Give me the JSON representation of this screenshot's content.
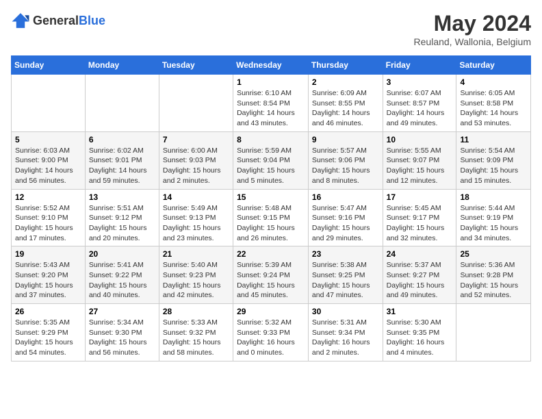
{
  "logo": {
    "general": "General",
    "blue": "Blue"
  },
  "title": "May 2024",
  "subtitle": "Reuland, Wallonia, Belgium",
  "days_header": [
    "Sunday",
    "Monday",
    "Tuesday",
    "Wednesday",
    "Thursday",
    "Friday",
    "Saturday"
  ],
  "weeks": [
    [
      {
        "num": "",
        "sunrise": "",
        "sunset": "",
        "daylight": ""
      },
      {
        "num": "",
        "sunrise": "",
        "sunset": "",
        "daylight": ""
      },
      {
        "num": "",
        "sunrise": "",
        "sunset": "",
        "daylight": ""
      },
      {
        "num": "1",
        "sunrise": "Sunrise: 6:10 AM",
        "sunset": "Sunset: 8:54 PM",
        "daylight": "Daylight: 14 hours and 43 minutes."
      },
      {
        "num": "2",
        "sunrise": "Sunrise: 6:09 AM",
        "sunset": "Sunset: 8:55 PM",
        "daylight": "Daylight: 14 hours and 46 minutes."
      },
      {
        "num": "3",
        "sunrise": "Sunrise: 6:07 AM",
        "sunset": "Sunset: 8:57 PM",
        "daylight": "Daylight: 14 hours and 49 minutes."
      },
      {
        "num": "4",
        "sunrise": "Sunrise: 6:05 AM",
        "sunset": "Sunset: 8:58 PM",
        "daylight": "Daylight: 14 hours and 53 minutes."
      }
    ],
    [
      {
        "num": "5",
        "sunrise": "Sunrise: 6:03 AM",
        "sunset": "Sunset: 9:00 PM",
        "daylight": "Daylight: 14 hours and 56 minutes."
      },
      {
        "num": "6",
        "sunrise": "Sunrise: 6:02 AM",
        "sunset": "Sunset: 9:01 PM",
        "daylight": "Daylight: 14 hours and 59 minutes."
      },
      {
        "num": "7",
        "sunrise": "Sunrise: 6:00 AM",
        "sunset": "Sunset: 9:03 PM",
        "daylight": "Daylight: 15 hours and 2 minutes."
      },
      {
        "num": "8",
        "sunrise": "Sunrise: 5:59 AM",
        "sunset": "Sunset: 9:04 PM",
        "daylight": "Daylight: 15 hours and 5 minutes."
      },
      {
        "num": "9",
        "sunrise": "Sunrise: 5:57 AM",
        "sunset": "Sunset: 9:06 PM",
        "daylight": "Daylight: 15 hours and 8 minutes."
      },
      {
        "num": "10",
        "sunrise": "Sunrise: 5:55 AM",
        "sunset": "Sunset: 9:07 PM",
        "daylight": "Daylight: 15 hours and 12 minutes."
      },
      {
        "num": "11",
        "sunrise": "Sunrise: 5:54 AM",
        "sunset": "Sunset: 9:09 PM",
        "daylight": "Daylight: 15 hours and 15 minutes."
      }
    ],
    [
      {
        "num": "12",
        "sunrise": "Sunrise: 5:52 AM",
        "sunset": "Sunset: 9:10 PM",
        "daylight": "Daylight: 15 hours and 17 minutes."
      },
      {
        "num": "13",
        "sunrise": "Sunrise: 5:51 AM",
        "sunset": "Sunset: 9:12 PM",
        "daylight": "Daylight: 15 hours and 20 minutes."
      },
      {
        "num": "14",
        "sunrise": "Sunrise: 5:49 AM",
        "sunset": "Sunset: 9:13 PM",
        "daylight": "Daylight: 15 hours and 23 minutes."
      },
      {
        "num": "15",
        "sunrise": "Sunrise: 5:48 AM",
        "sunset": "Sunset: 9:15 PM",
        "daylight": "Daylight: 15 hours and 26 minutes."
      },
      {
        "num": "16",
        "sunrise": "Sunrise: 5:47 AM",
        "sunset": "Sunset: 9:16 PM",
        "daylight": "Daylight: 15 hours and 29 minutes."
      },
      {
        "num": "17",
        "sunrise": "Sunrise: 5:45 AM",
        "sunset": "Sunset: 9:17 PM",
        "daylight": "Daylight: 15 hours and 32 minutes."
      },
      {
        "num": "18",
        "sunrise": "Sunrise: 5:44 AM",
        "sunset": "Sunset: 9:19 PM",
        "daylight": "Daylight: 15 hours and 34 minutes."
      }
    ],
    [
      {
        "num": "19",
        "sunrise": "Sunrise: 5:43 AM",
        "sunset": "Sunset: 9:20 PM",
        "daylight": "Daylight: 15 hours and 37 minutes."
      },
      {
        "num": "20",
        "sunrise": "Sunrise: 5:41 AM",
        "sunset": "Sunset: 9:22 PM",
        "daylight": "Daylight: 15 hours and 40 minutes."
      },
      {
        "num": "21",
        "sunrise": "Sunrise: 5:40 AM",
        "sunset": "Sunset: 9:23 PM",
        "daylight": "Daylight: 15 hours and 42 minutes."
      },
      {
        "num": "22",
        "sunrise": "Sunrise: 5:39 AM",
        "sunset": "Sunset: 9:24 PM",
        "daylight": "Daylight: 15 hours and 45 minutes."
      },
      {
        "num": "23",
        "sunrise": "Sunrise: 5:38 AM",
        "sunset": "Sunset: 9:25 PM",
        "daylight": "Daylight: 15 hours and 47 minutes."
      },
      {
        "num": "24",
        "sunrise": "Sunrise: 5:37 AM",
        "sunset": "Sunset: 9:27 PM",
        "daylight": "Daylight: 15 hours and 49 minutes."
      },
      {
        "num": "25",
        "sunrise": "Sunrise: 5:36 AM",
        "sunset": "Sunset: 9:28 PM",
        "daylight": "Daylight: 15 hours and 52 minutes."
      }
    ],
    [
      {
        "num": "26",
        "sunrise": "Sunrise: 5:35 AM",
        "sunset": "Sunset: 9:29 PM",
        "daylight": "Daylight: 15 hours and 54 minutes."
      },
      {
        "num": "27",
        "sunrise": "Sunrise: 5:34 AM",
        "sunset": "Sunset: 9:30 PM",
        "daylight": "Daylight: 15 hours and 56 minutes."
      },
      {
        "num": "28",
        "sunrise": "Sunrise: 5:33 AM",
        "sunset": "Sunset: 9:32 PM",
        "daylight": "Daylight: 15 hours and 58 minutes."
      },
      {
        "num": "29",
        "sunrise": "Sunrise: 5:32 AM",
        "sunset": "Sunset: 9:33 PM",
        "daylight": "Daylight: 16 hours and 0 minutes."
      },
      {
        "num": "30",
        "sunrise": "Sunrise: 5:31 AM",
        "sunset": "Sunset: 9:34 PM",
        "daylight": "Daylight: 16 hours and 2 minutes."
      },
      {
        "num": "31",
        "sunrise": "Sunrise: 5:30 AM",
        "sunset": "Sunset: 9:35 PM",
        "daylight": "Daylight: 16 hours and 4 minutes."
      },
      {
        "num": "",
        "sunrise": "",
        "sunset": "",
        "daylight": ""
      }
    ]
  ]
}
